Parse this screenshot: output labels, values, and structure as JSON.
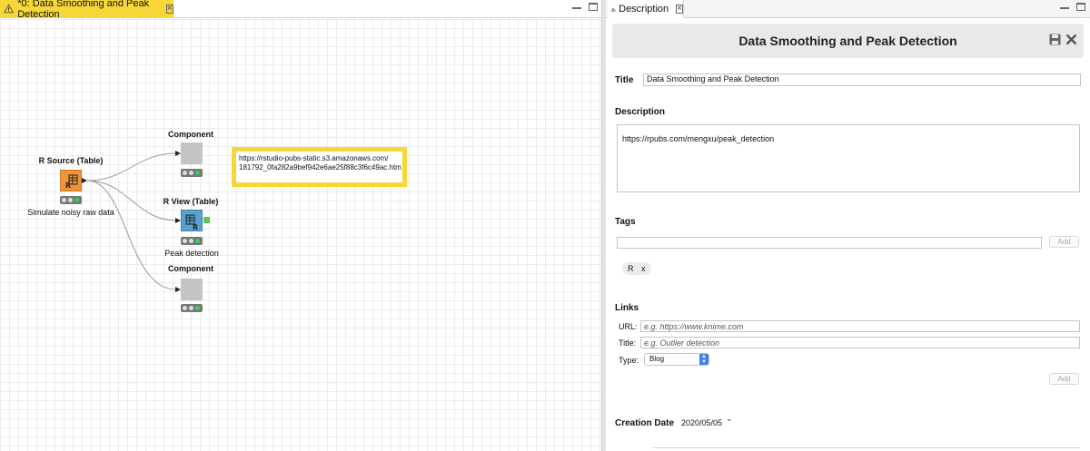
{
  "editor": {
    "tab_title": "*0: Data Smoothing and Peak Detection",
    "nodes": {
      "r_source": {
        "title": "R Source (Table)",
        "label": "Simulate noisy raw data"
      },
      "component_top": {
        "title": "Component"
      },
      "r_view": {
        "title": "R View (Table)",
        "label": "Peak detection"
      },
      "component_bottom": {
        "title": "Component"
      }
    },
    "annotation": {
      "line1": "https://rstudio-pubs-static.s3.amazonaws.com/",
      "line2": "181792_0fa282a9bef942e6ae25f88c3f6c49ac.htm"
    }
  },
  "description": {
    "tab_label": "Description",
    "header_title": "Data Smoothing and Peak Detection",
    "title_label": "Title",
    "title_value": "Data Smoothing and Peak Detection",
    "description_label": "Description",
    "description_value": "https://rpubs.com/mengxu/peak_detection",
    "tags_label": "Tags",
    "tags_add": "Add",
    "tags": [
      {
        "text": "R",
        "remove": "x"
      }
    ],
    "links_label": "Links",
    "url_label": "URL:",
    "url_placeholder": "e.g. https://www.knime.com",
    "link_title_label": "Title:",
    "link_title_placeholder": "e.g. Outlier detection",
    "type_label": "Type:",
    "type_value": "Blog",
    "links_add": "Add",
    "creation_date_label": "Creation Date",
    "creation_date_value": "2020/05/05"
  },
  "colors": {
    "accent_yellow": "#f6d737",
    "r_source_orange": "#f0943b",
    "r_view_blue": "#5ba1cf",
    "component_gray": "#c4c4c4",
    "port_green": "#5fc45f"
  }
}
